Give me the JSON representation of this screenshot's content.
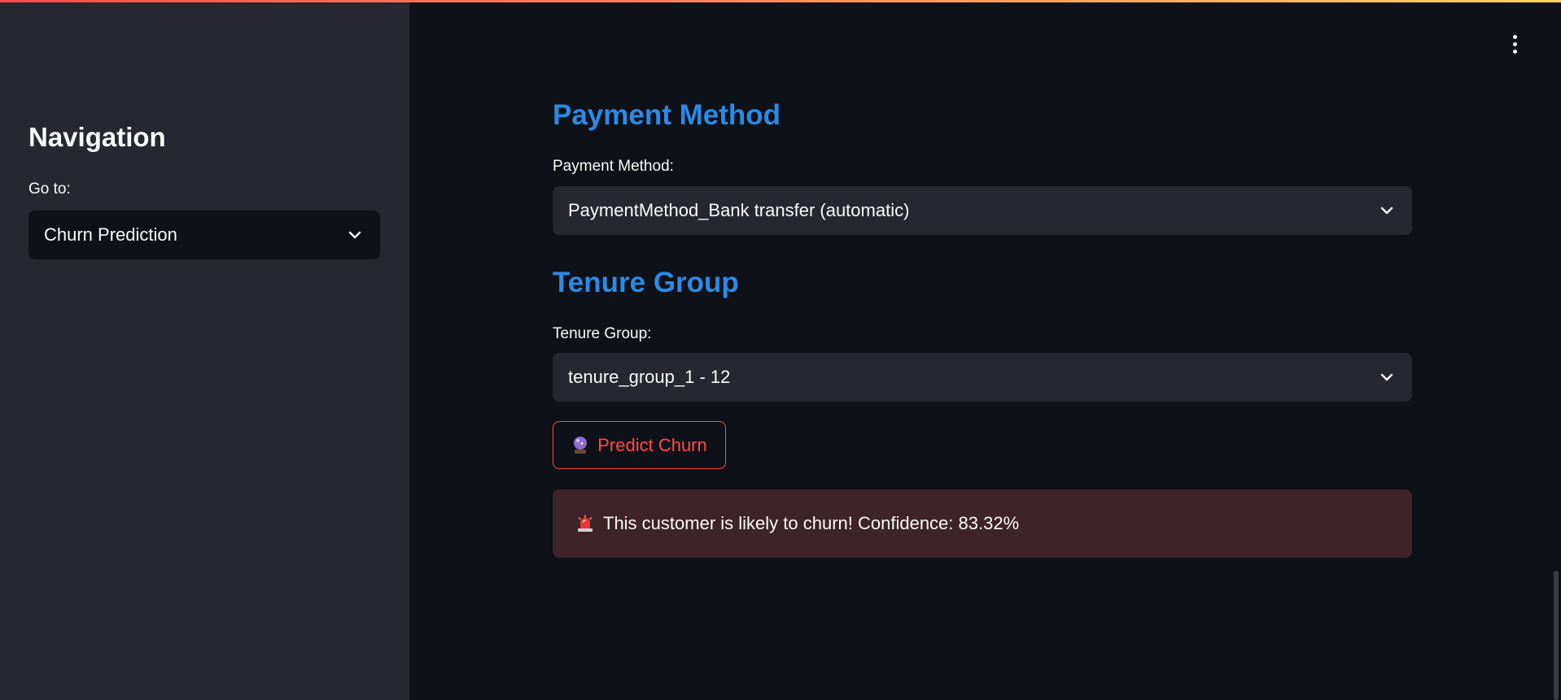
{
  "colors": {
    "accent_heading": "#2b8ae6",
    "button_accent": "#ff4b4b",
    "alert_background": "#3e2328",
    "sidebar_background": "#262730",
    "main_background": "#0e1117"
  },
  "sidebar": {
    "title": "Navigation",
    "select_label": "Go to:",
    "selected_page": "Churn Prediction",
    "select_icon": "chevron-down-icon"
  },
  "header": {
    "menu_icon": "more-vertical-icon"
  },
  "main": {
    "payment_section": {
      "heading": "Payment Method",
      "label": "Payment Method:",
      "selected_value": "PaymentMethod_Bank transfer (automatic)"
    },
    "tenure_section": {
      "heading": "Tenure Group",
      "label": "Tenure Group:",
      "selected_value": "tenure_group_1 - 12"
    },
    "predict_button": {
      "icon": "crystal-ball-icon",
      "label": "Predict Churn"
    },
    "result_alert": {
      "icon": "siren-icon",
      "message": "This customer is likely to churn! Confidence: 83.32%"
    }
  }
}
